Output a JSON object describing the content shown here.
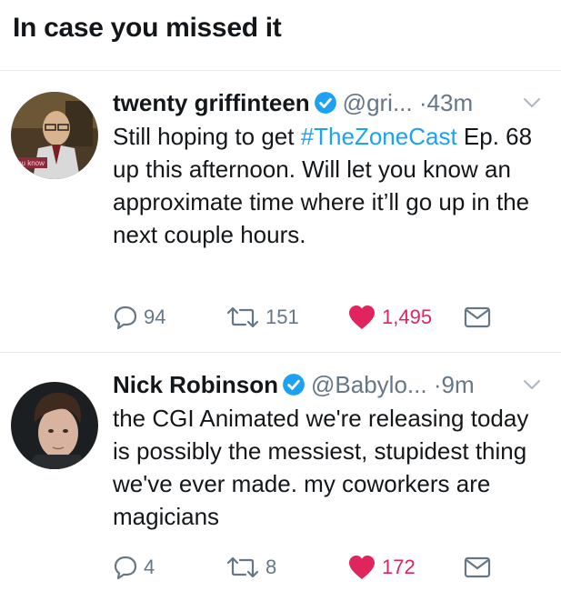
{
  "header": {
    "title": "In case you missed it"
  },
  "tweets": [
    {
      "name": "twenty griffinteen",
      "handle": "@gri...",
      "dot": "·",
      "time": "43m",
      "text_before": "Still hoping to get ",
      "hashtag": "#TheZoneCast",
      "text_after": " Ep. 68 up this afternoon. Will let you know an approximate time where it’ll go up in the next couple hours.",
      "avatar_caption": "you know",
      "replies": "94",
      "retweets": "151",
      "likes": "1,495",
      "icons": {
        "reply": "reply-icon",
        "retweet": "retweet-icon",
        "like": "heart-icon",
        "dm": "envelope-icon",
        "verified": "verified-badge-icon",
        "menu": "chevron-down-icon"
      }
    },
    {
      "name": "Nick Robinson",
      "handle": "@Babylo...",
      "dot": "·",
      "time": "9m",
      "text": "the CGI Animated we're releasing today is possibly the messiest, stupidest thing we've ever made. my coworkers are magicians",
      "replies": "4",
      "retweets": "8",
      "likes": "172",
      "icons": {
        "reply": "reply-icon",
        "retweet": "retweet-icon",
        "like": "heart-icon",
        "dm": "envelope-icon",
        "verified": "verified-badge-icon",
        "menu": "chevron-down-icon"
      }
    }
  ],
  "colors": {
    "link": "#1da1f2",
    "like": "#e0245e",
    "muted": "#657786",
    "text": "#14171a",
    "divider": "#e1e8ed"
  }
}
